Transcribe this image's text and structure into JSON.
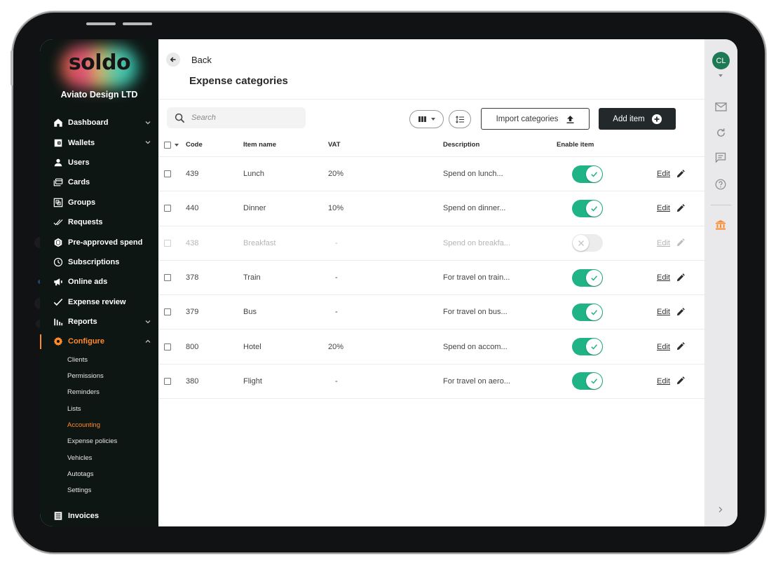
{
  "app": {
    "brand": "soldo",
    "company": "Aviato Design LTD",
    "accent_color": "#ff8a2b",
    "toggle_on_color": "#1fb386"
  },
  "sidebar": {
    "items": [
      {
        "label": "Dashboard",
        "icon": "home-icon",
        "expandable": true
      },
      {
        "label": "Wallets",
        "icon": "wallet-icon",
        "expandable": true
      },
      {
        "label": "Users",
        "icon": "user-icon",
        "expandable": false
      },
      {
        "label": "Cards",
        "icon": "cards-icon",
        "expandable": false
      },
      {
        "label": "Groups",
        "icon": "groups-icon",
        "expandable": false
      },
      {
        "label": "Requests",
        "icon": "double-check-icon",
        "expandable": false
      },
      {
        "label": "Pre-approved spend",
        "icon": "hexagon-icon",
        "expandable": false
      },
      {
        "label": "Subscriptions",
        "icon": "clock-icon",
        "expandable": false
      },
      {
        "label": "Online ads",
        "icon": "megaphone-icon",
        "expandable": false
      },
      {
        "label": "Expense review",
        "icon": "check-icon",
        "expandable": false
      },
      {
        "label": "Reports",
        "icon": "bar-chart-icon",
        "expandable": true
      },
      {
        "label": "Configure",
        "icon": "gear-icon",
        "expandable": true,
        "active": true
      }
    ],
    "configure_subitems": [
      {
        "label": "Clients"
      },
      {
        "label": "Permissions"
      },
      {
        "label": "Reminders"
      },
      {
        "label": "Lists"
      },
      {
        "label": "Accounting",
        "active": true
      },
      {
        "label": "Expense policies"
      },
      {
        "label": "Vehicles"
      },
      {
        "label": "Autotags"
      },
      {
        "label": "Settings"
      }
    ],
    "footer_item": {
      "label": "Invoices",
      "icon": "invoice-icon"
    }
  },
  "header": {
    "back_label": "Back",
    "title": "Expense categories"
  },
  "toolbar": {
    "search_placeholder": "Search",
    "import_label": "Import categories",
    "add_label": "Add item"
  },
  "table": {
    "columns": [
      "Code",
      "Item name",
      "VAT",
      "Description",
      "Enable item"
    ],
    "edit_label": "Edit",
    "rows": [
      {
        "code": "439",
        "name": "Lunch",
        "vat": "20%",
        "description": "Spend on lunch...",
        "enabled": true
      },
      {
        "code": "440",
        "name": "Dinner",
        "vat": "10%",
        "description": "Spend on dinner...",
        "enabled": true
      },
      {
        "code": "438",
        "name": "Breakfast",
        "vat": "-",
        "description": "Spend on breakfa...",
        "enabled": false
      },
      {
        "code": "378",
        "name": "Train",
        "vat": "-",
        "description": "For travel on train...",
        "enabled": true
      },
      {
        "code": "379",
        "name": "Bus",
        "vat": "-",
        "description": "For travel on bus...",
        "enabled": true
      },
      {
        "code": "800",
        "name": "Hotel",
        "vat": "20%",
        "description": "Spend on accom...",
        "enabled": true
      },
      {
        "code": "380",
        "name": "Flight",
        "vat": "-",
        "description": "For travel on aero...",
        "enabled": true
      }
    ]
  },
  "rail": {
    "avatar_initials": "CL",
    "avatar_color": "#1e7a55",
    "icons": [
      "mail-icon",
      "refresh-icon",
      "chat-icon",
      "help-icon",
      "bank-icon"
    ]
  }
}
